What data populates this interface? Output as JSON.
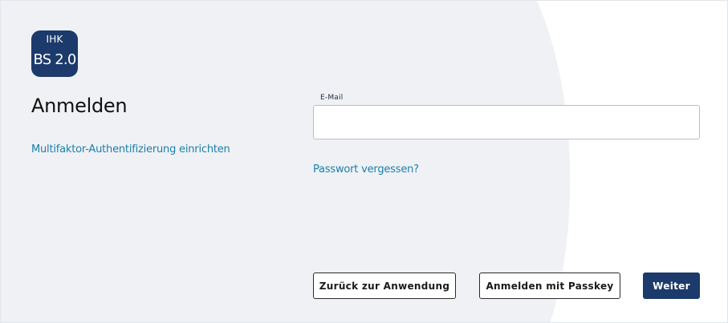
{
  "logo": {
    "line1": "IHK",
    "line2": "BS 2.0"
  },
  "title": "Anmelden",
  "mfa_link": "Multifaktor-Authentifizierung einrichten",
  "email": {
    "label": "E-Mail",
    "value": "",
    "placeholder": ""
  },
  "forgot_password_link": "Passwort vergessen?",
  "buttons": {
    "back": "Zurück zur Anwendung",
    "passkey": "Anmelden mit Passkey",
    "next": "Weiter"
  },
  "colors": {
    "brand": "#1c3a6b",
    "link": "#1b7fac",
    "background_shape": "#eff1f4"
  }
}
